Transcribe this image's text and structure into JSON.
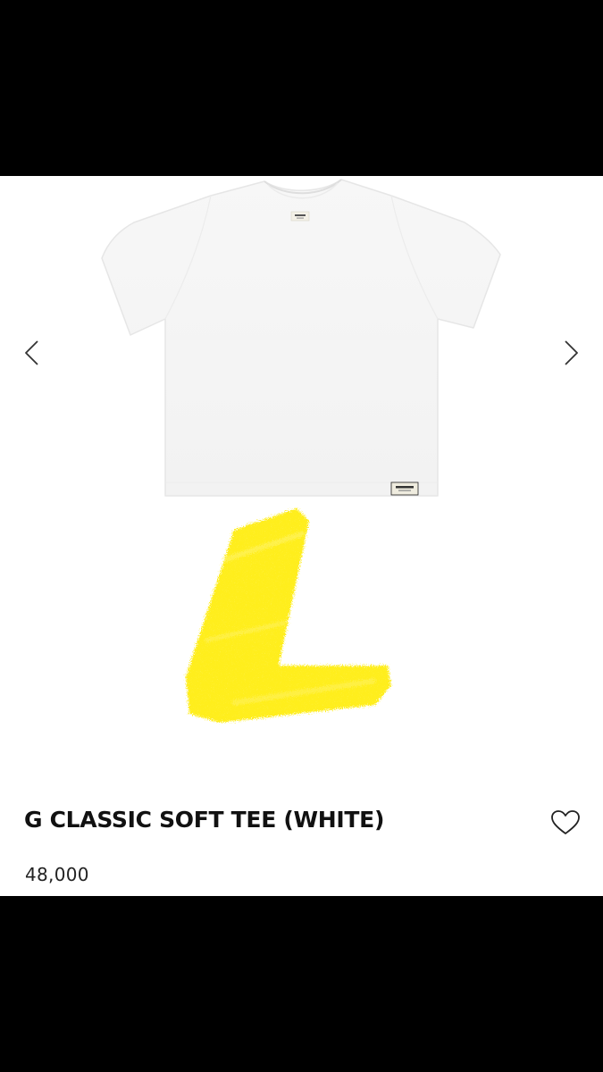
{
  "product": {
    "title": "G CLASSIC SOFT TEE (WHITE)",
    "price": "48,000",
    "size_mark": "L",
    "label_text": "G.CMPN"
  },
  "gallery": {
    "prev_icon": "chevron-left-icon",
    "next_icon": "chevron-right-icon"
  },
  "actions": {
    "wishlist_icon": "heart-outline-icon"
  },
  "colors": {
    "background": "#ffffff",
    "frame": "#000000",
    "size_mark": "#ffee1a",
    "text": "#111111"
  }
}
